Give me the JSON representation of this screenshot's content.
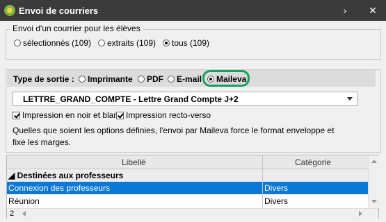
{
  "window": {
    "title": "Envoi de courriers",
    "icon": "pronote-app-icon",
    "chevron_icon": "chevron-right-icon",
    "close_icon": "close-icon"
  },
  "recipients": {
    "legend": "Envoi d'un courrier pour les élèves",
    "options": [
      {
        "label": "sélectionnés (109)",
        "selected": false
      },
      {
        "label": "extraits (109)",
        "selected": false
      },
      {
        "label": "tous (109)",
        "selected": true
      }
    ]
  },
  "output": {
    "type_label": "Type de sortie :",
    "options": [
      {
        "label": "Imprimante",
        "selected": false
      },
      {
        "label": "PDF",
        "selected": false
      },
      {
        "label": "E-mail",
        "selected": false
      },
      {
        "label": "Maileva",
        "selected": true
      }
    ],
    "highlight_color": "#17a05d",
    "letter_select": "LETTRE_GRAND_COMPTE - Lettre Grand Compte J+2",
    "check_bw": "Impression en noir et blanc",
    "check_recto": "Impression recto-verso",
    "note": "Quelles que soient les options définies, l'envoi par Maileva force le format enveloppe et fixe les marges."
  },
  "table": {
    "columns": [
      "Libellé",
      "Catégorie"
    ],
    "group": "Destinées aux professeurs",
    "rows": [
      {
        "libelle": "Connexion des professeurs",
        "categorie": "Divers",
        "selected": true
      },
      {
        "libelle": "Réunion",
        "categorie": "Divers",
        "selected": false
      }
    ],
    "count": "2",
    "selection_color": "#0a78d7"
  }
}
